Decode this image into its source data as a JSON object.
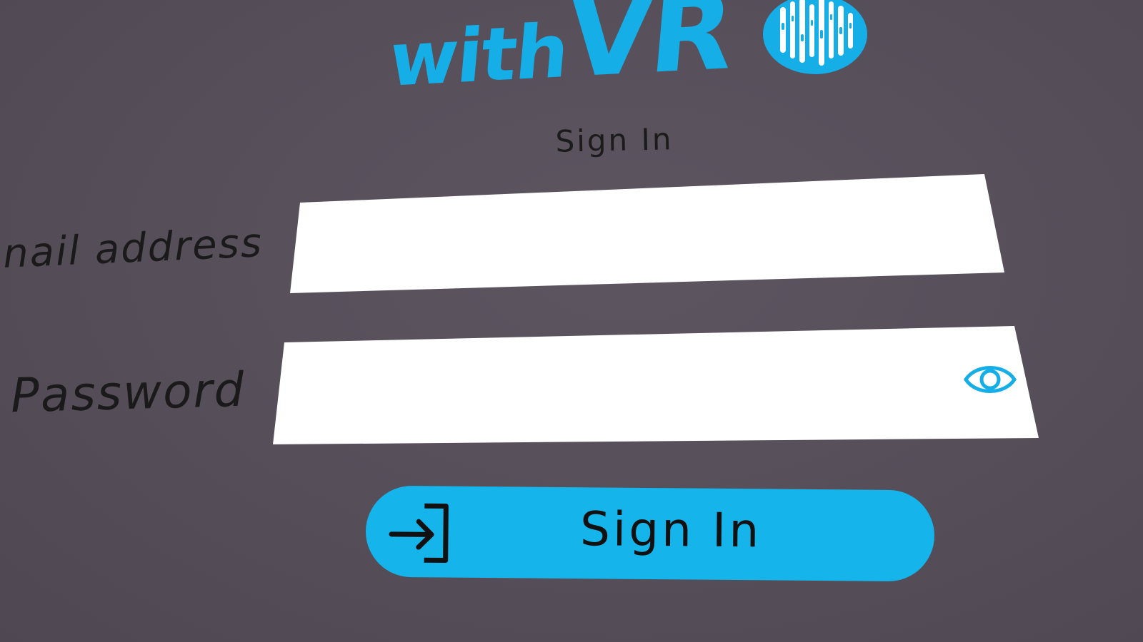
{
  "brand": {
    "name_part1": "with",
    "name_part2": "VR",
    "color": "#16aee6"
  },
  "page": {
    "title": "Sign In"
  },
  "form": {
    "email_label": "nail address",
    "email_value": "",
    "password_label": "Password",
    "password_value": "",
    "password_toggle_icon": "eye-icon"
  },
  "actions": {
    "signin_label": "Sign In",
    "signin_icon": "sign-in-arrow-icon",
    "button_color": "#15b4eb"
  },
  "colors": {
    "background": "#574f5a",
    "field": "#ffffff",
    "accent": "#16aee6"
  }
}
